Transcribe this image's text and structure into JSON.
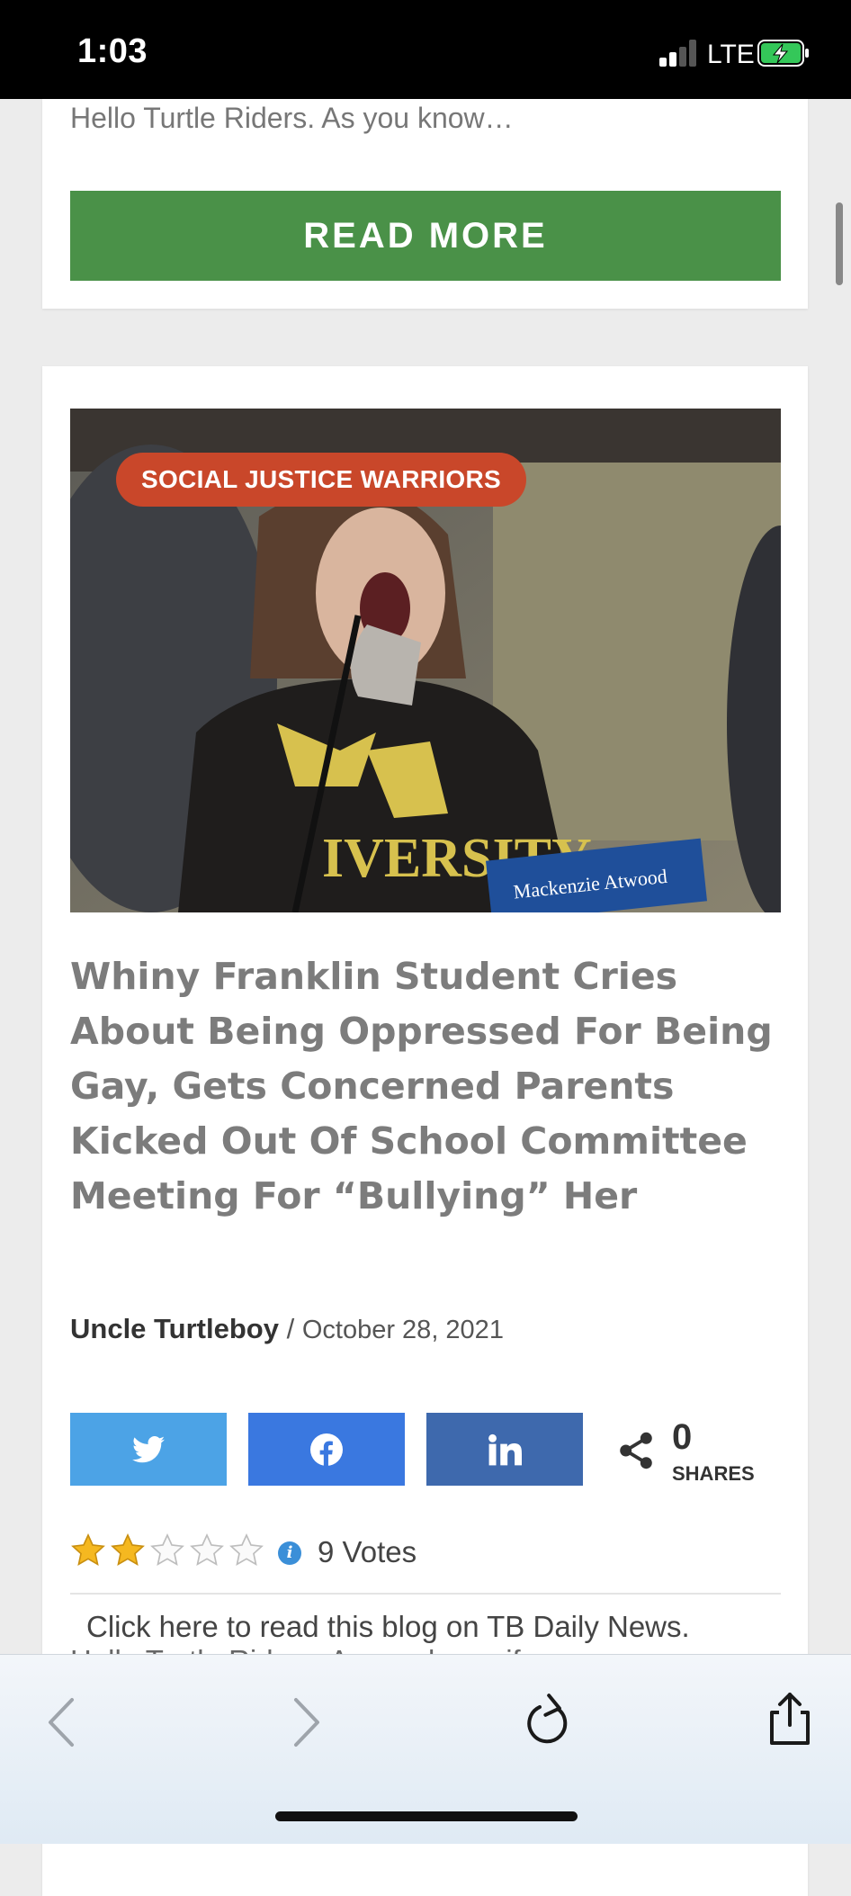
{
  "status_bar": {
    "time": "1:03",
    "network": "LTE"
  },
  "prev_card": {
    "excerpt": "Hello Turtle Riders. As you know…",
    "read_more_label": "READ MORE"
  },
  "article": {
    "category": "SOCIAL JUSTICE WARRIORS",
    "image_nameplate": "Mackenzie Atwood",
    "title": "Whiny Franklin Student Cries About Being Oppressed For Being Gay, Gets Concerned Parents Kicked Out Of School Committee Meeting For “Bullying” Her",
    "author": "Uncle Turtleboy",
    "separator": "/",
    "date": "October 28, 2021",
    "share": {
      "count": "0",
      "label": "SHARES",
      "buttons": [
        "twitter-icon",
        "facebook-icon",
        "linkedin-icon"
      ]
    },
    "rating": {
      "filled_stars": 2,
      "total_stars": 5,
      "info_glyph": "i",
      "votes": "9 Votes"
    },
    "excerpt": "Click here to read this blog on TB Daily News.",
    "excerpt_cut": "Hello Turtle Riders. As you know if"
  },
  "colors": {
    "read_more": "#4a9148",
    "category_pill": "#c9472a",
    "twitter": "#4ca3e6",
    "facebook": "#3a78e0",
    "linkedin": "#3e69ad",
    "star": "#f5b820"
  }
}
